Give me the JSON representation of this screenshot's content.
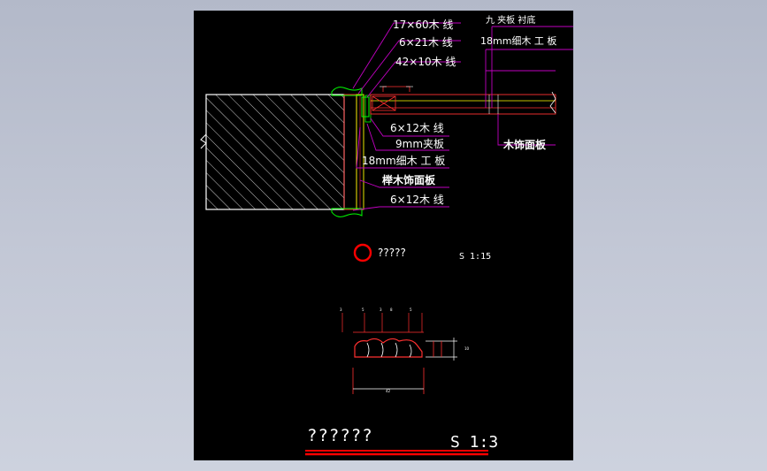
{
  "callouts_upper": [
    "17×60木 线",
    "6×21木 线",
    "42×10木 线"
  ],
  "callouts_right": [
    "九 夹板 衬底",
    "18mm细木 工 板"
  ],
  "callouts_lower": [
    "6×12木 线",
    "9mm夹板",
    "18mm细木 工 板",
    "榉木饰面板",
    "6×12木 线"
  ],
  "wood_facing_label": "木饰面板",
  "symbol_label": "?????",
  "scale_small": "S 1:15",
  "title": "??????",
  "scale_large": "S 1:3",
  "colors": {
    "background": "#000000",
    "line_magenta": "#c000c0",
    "line_green": "#00ff00",
    "line_white": "#ffffff",
    "line_red": "#ff0000",
    "line_yellow": "#ffff00"
  }
}
